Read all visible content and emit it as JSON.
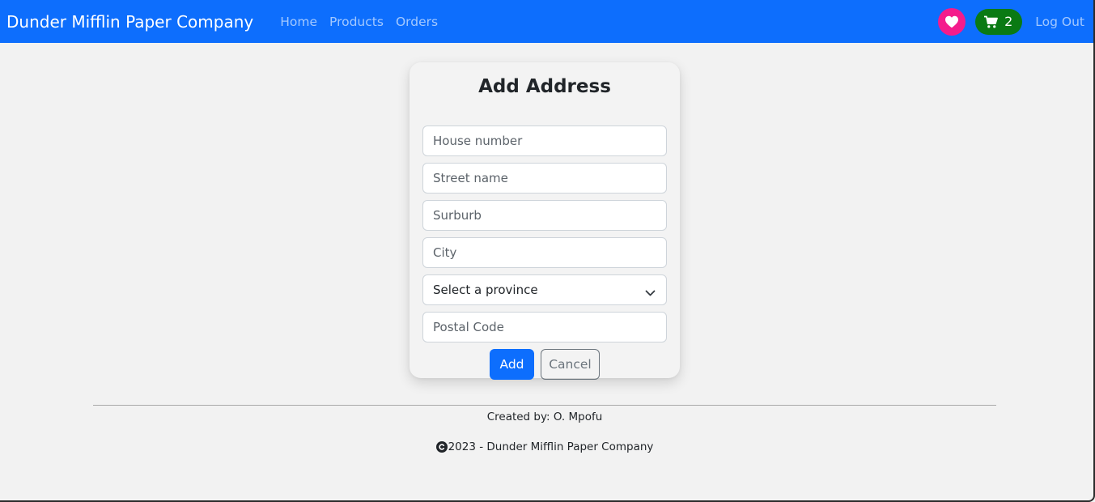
{
  "navbar": {
    "brand": "Dunder Mifflin Paper Company",
    "links": [
      "Home",
      "Products",
      "Orders"
    ],
    "cart_count": "2",
    "logout_label": "Log Out",
    "colors": {
      "bar": "#0d6efd",
      "favorite": "#f41c8c",
      "cart": "#0a7a13"
    },
    "icons": {
      "favorite": "heart-icon",
      "cart": "cart-icon"
    }
  },
  "form": {
    "title": "Add Address",
    "fields": {
      "house_number": {
        "placeholder": "House number",
        "value": ""
      },
      "street_name": {
        "placeholder": "Street name",
        "value": ""
      },
      "suburb": {
        "placeholder": "Surburb",
        "value": ""
      },
      "city": {
        "placeholder": "City",
        "value": ""
      },
      "province": {
        "selected": "Select a province"
      },
      "postal_code": {
        "placeholder": "Postal Code",
        "value": ""
      }
    },
    "add_label": "Add",
    "cancel_label": "Cancel"
  },
  "footer": {
    "credit": "Created by: O. Mpofu",
    "copyright": "2023 - Dunder Mifflin Paper Company",
    "icon": "copyright-icon"
  }
}
